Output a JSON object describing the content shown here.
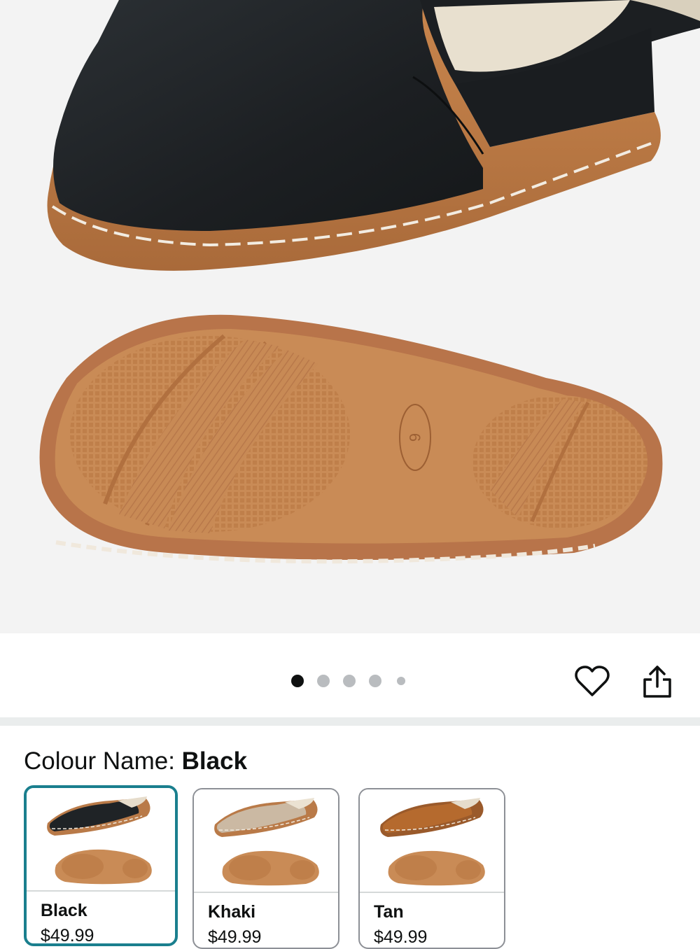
{
  "gallery": {
    "image_count": 5,
    "active_index": 0,
    "sole_size_mark": "6"
  },
  "actions": {
    "wishlist_icon": "heart-outline-icon",
    "share_icon": "share-icon"
  },
  "colour": {
    "label": "Colour Name:",
    "selected": "Black",
    "options": [
      {
        "name": "Black",
        "price": "$49.99",
        "upper_color": "#1f2326",
        "selected": true
      },
      {
        "name": "Khaki",
        "price": "$49.99",
        "upper_color": "#cbb9a3",
        "selected": false
      },
      {
        "name": "Tan",
        "price": "$49.99",
        "upper_color": "#b56a2e",
        "selected": false
      }
    ]
  },
  "colors": {
    "accent_teal": "#1a7f8e",
    "sole_tan": "#c98a52",
    "sole_dark": "#a8683a",
    "upper_black": "#1f2326"
  }
}
